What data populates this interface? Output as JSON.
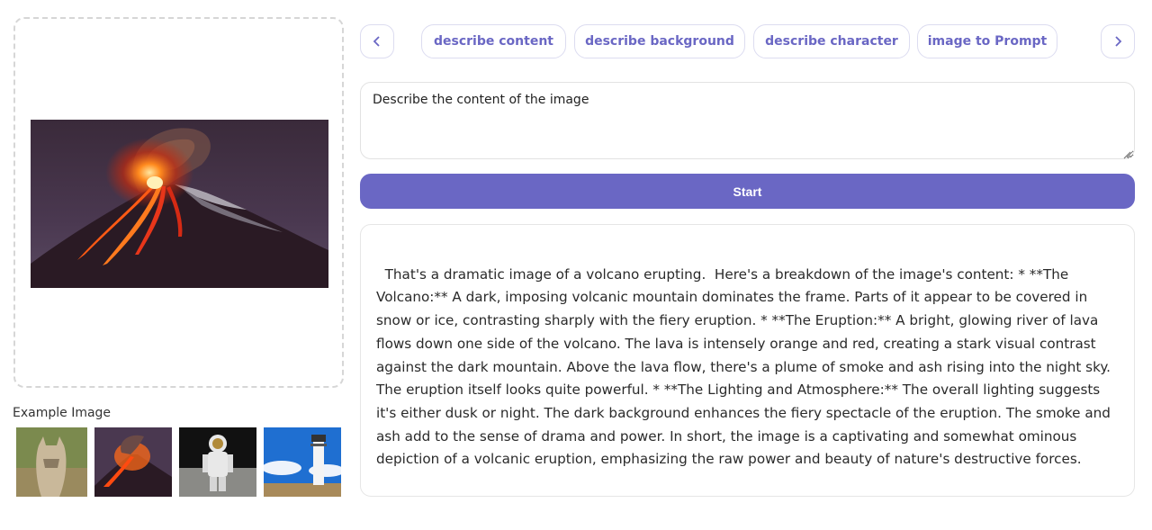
{
  "preview": {
    "image_name": "volcano-eruption-image"
  },
  "examples": {
    "label": "Example Image",
    "items": [
      {
        "name": "lynx-example"
      },
      {
        "name": "volcano-example"
      },
      {
        "name": "astronaut-example"
      },
      {
        "name": "lighthouse-example"
      }
    ]
  },
  "tabs": {
    "prev_icon": "chevron-left-icon",
    "next_icon": "chevron-right-icon",
    "items": [
      {
        "label": "describe content"
      },
      {
        "label": "describe background"
      },
      {
        "label": "describe character"
      },
      {
        "label": "image to Prompt"
      }
    ]
  },
  "prompt": {
    "value": "Describe the content of the image"
  },
  "start_button": {
    "label": "Start"
  },
  "result": {
    "text": "That's a dramatic image of a volcano erupting.  Here's a breakdown of the image's content: * **The Volcano:** A dark, imposing volcanic mountain dominates the frame. Parts of it appear to be covered in snow or ice, contrasting sharply with the fiery eruption. * **The Eruption:** A bright, glowing river of lava flows down one side of the volcano. The lava is intensely orange and red, creating a stark visual contrast against the dark mountain. Above the lava flow, there's a plume of smoke and ash rising into the night sky. The eruption itself looks quite powerful. * **The Lighting and Atmosphere:** The overall lighting suggests it's either dusk or night. The dark background enhances the fiery spectacle of the eruption. The smoke and ash add to the sense of drama and power. In short, the image is a captivating and somewhat ominous depiction of a volcanic eruption, emphasizing the raw power and beauty of nature's destructive forces."
  },
  "colors": {
    "accent": "#6a67c4",
    "border": "#dcdcf0"
  }
}
